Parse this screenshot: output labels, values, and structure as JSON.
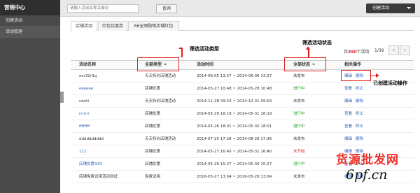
{
  "sidebar": {
    "brand": "营销中心",
    "items": [
      {
        "label": "创建活动"
      },
      {
        "label": "活动管理"
      }
    ]
  },
  "topbar": {
    "search_placeholder": "请输入活动名称关键词",
    "search_button": "查询",
    "create_button": "创建活动"
  },
  "tabs": [
    {
      "label": "店铺活动"
    },
    {
      "label": "红包优惠券"
    },
    {
      "label": "66全网购物店铺红包"
    }
  ],
  "pagination": {
    "count_prefix": "共",
    "count": "390",
    "count_suffix": "个活动",
    "page": "1/39",
    "prev": "‹",
    "next": "›"
  },
  "table": {
    "headers": {
      "name": "活动名称",
      "type": "全部类型",
      "time": "活动时间",
      "status": "全部状态",
      "ops": "相关操作"
    },
    "rows": [
      {
        "name": "evr32r3q",
        "type": "天天特价店铺活动",
        "time": "2014-06-05 13:27 ~ 2014-06-06 13:27",
        "status": "未发布",
        "ops": [
          "编辑",
          "删除"
        ]
      },
      {
        "name": "eeeeee",
        "type": "店铺优惠",
        "time": "2014-05-27 10:48 ~ 2014-05-28 10:48",
        "status": "进行中",
        "ops": [
          "查看",
          "终止"
        ]
      },
      {
        "name": "cashi",
        "type": "天天特价店铺活动",
        "time": "2014-11-28 09:53 ~ 2014-12-31 09:53",
        "status": "未发布",
        "ops": [
          "编辑",
          "删除"
        ]
      },
      {
        "name": "rrrrrrr",
        "type": "店铺优惠",
        "time": "2014-05-29 16:19 ~ 2014-05-31 16:19",
        "status": "进行中",
        "ops": [
          "查看",
          "终止"
        ]
      },
      {
        "name": "ffffffff",
        "type": "店铺优惠",
        "time": "2014-05-26 18:01 ~ 2014-05-30 18:01",
        "status": "进行中",
        "ops": [
          "查看",
          "终止"
        ]
      },
      {
        "name": "dddddddddd",
        "type": "天天特价店铺活动",
        "time": "2014-07-25 17:28 ~ 2014-08-28 17:36",
        "status": "未发布",
        "ops": [
          "编辑",
          "删除"
        ]
      },
      {
        "name": "111",
        "type": "店铺优惠",
        "time": "2014-05-27 16:40 ~ 2014-05-31 16:40",
        "status": "未开始",
        "ops": [
          "编辑",
          "删除"
        ]
      },
      {
        "name": "店铺优惠333",
        "type": "店铺优惠",
        "time": "2014-05-26 15:27 ~ 2014-05-30 15:27",
        "status": "进行中",
        "ops": [
          "查看",
          "终止"
        ]
      },
      {
        "name": "店铺免费试用活动测试",
        "type": "免费试用",
        "time": "2016-05-27 13:04 ~ 2016-05-29 13:04",
        "status": "未发布",
        "ops": [
          "编辑",
          "删除"
        ]
      }
    ]
  },
  "annotations": {
    "filter_type": "筛选活动类型",
    "filter_status": "筛选活动状态",
    "created_ops": "已创建活动操作"
  },
  "watermark": {
    "cn": "货源批发网",
    "url": "6pf.cn"
  },
  "colors": {
    "sidebar_bg": "#4a4a4a",
    "link": "#2d62b4",
    "status_going": "#1aa01a",
    "status_unstarted": "#d9262e",
    "highlight": "#e01c1c",
    "watermark_red": "#e9322a"
  }
}
